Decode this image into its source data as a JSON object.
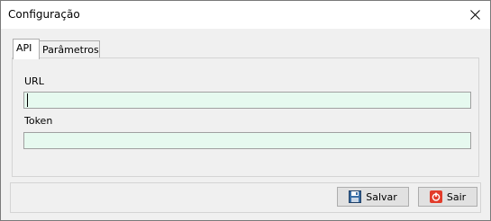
{
  "window": {
    "title": "Configuração",
    "close_icon": "close-icon"
  },
  "tabs": [
    {
      "label": "API",
      "active": true
    },
    {
      "label": "Parâmetros",
      "active": false
    }
  ],
  "api": {
    "url_label": "URL",
    "url_value": "",
    "token_label": "Token",
    "token_value": "",
    "field_color": "#e6f9ef"
  },
  "footer": {
    "save_label": "Salvar",
    "save_icon": "floppy-disk-icon",
    "exit_label": "Sair",
    "exit_icon": "power-icon",
    "exit_icon_color": "#e23c2b"
  }
}
